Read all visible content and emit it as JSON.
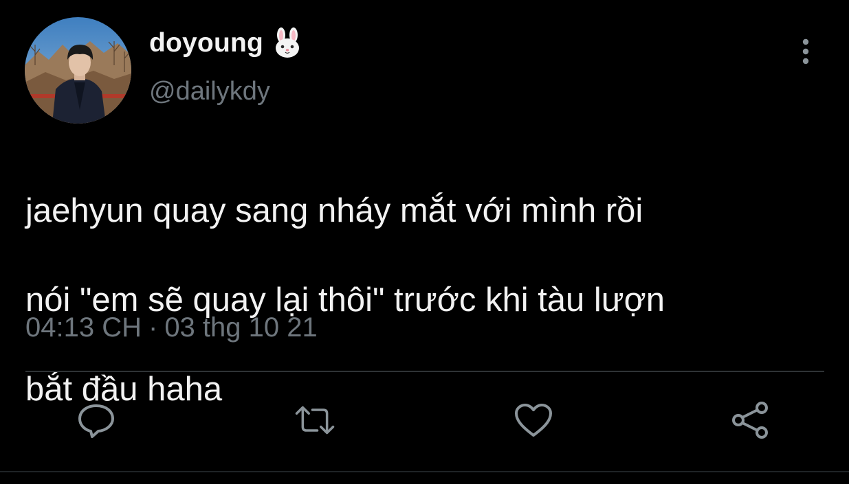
{
  "tweet": {
    "display_name": "doyoung",
    "name_emoji": "rabbit-face-emoji",
    "handle": "@dailykdy",
    "text_lines": [
      "jaehyun quay sang nháy mắt với mình rồi",
      "nói \"em sẽ quay lại thôi\" trước khi tàu lượn",
      "bắt đầu haha"
    ],
    "time": "04:13 CH",
    "separator": "·",
    "date": "03 thg 10 21"
  },
  "actions": [
    {
      "icon": "reply-icon"
    },
    {
      "icon": "retweet-icon"
    },
    {
      "icon": "like-icon"
    },
    {
      "icon": "share-icon"
    }
  ],
  "colors": {
    "background": "#000000",
    "text": "#f2f2f2",
    "secondary": "#6e767d",
    "divider": "#2f3336"
  }
}
